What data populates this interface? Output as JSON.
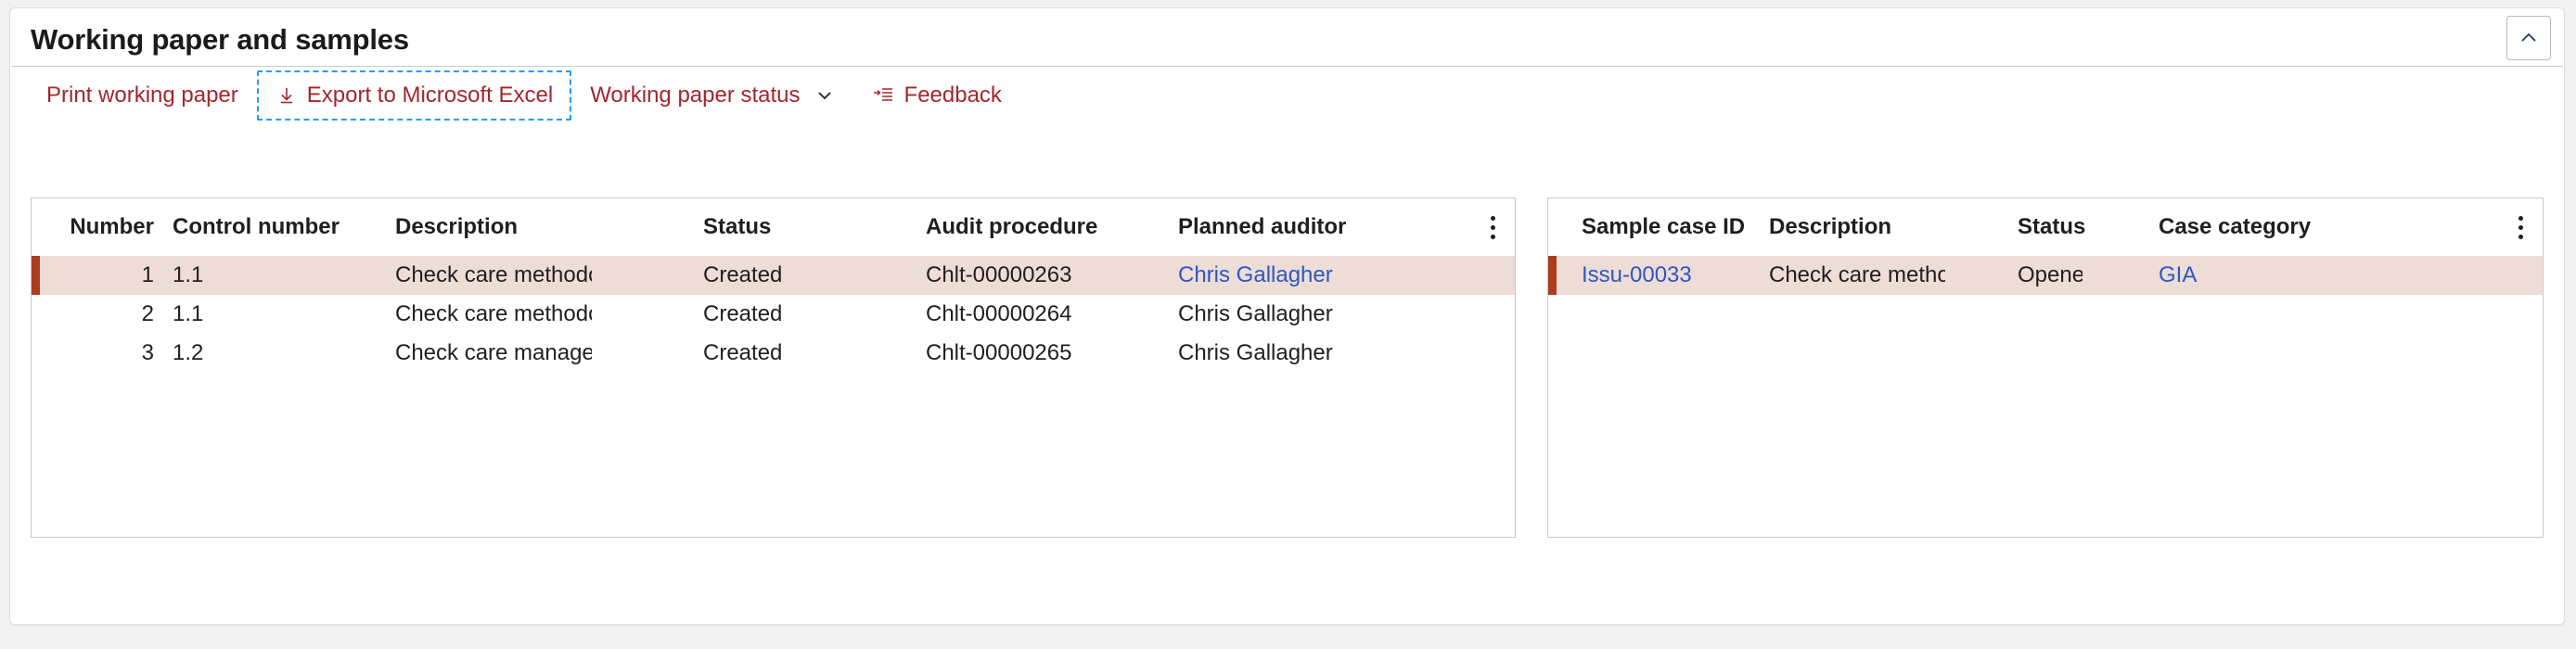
{
  "panel": {
    "title": "Working paper and samples",
    "collapse_icon": "chevron-up-icon"
  },
  "toolbar": {
    "buttons": [
      {
        "label": "Print working paper",
        "icon": null,
        "focused": false,
        "chevron": false
      },
      {
        "label": "Export to Microsoft Excel",
        "icon": "download-arrow-icon",
        "focused": true,
        "chevron": false
      },
      {
        "label": "Working paper status",
        "icon": null,
        "focused": false,
        "chevron": true
      },
      {
        "label": "Feedback",
        "icon": "arrow-to-list-icon",
        "focused": false,
        "chevron": false
      }
    ]
  },
  "colors": {
    "accent": "#a4262c",
    "link": "#2b58c4",
    "selected_row_bg": "#eedcd6",
    "selected_row_bar": "#ad3b1d",
    "focus_outline": "#2899f5"
  },
  "working_paper_grid": {
    "headers": [
      "Number",
      "Control number",
      "Description",
      "Status",
      "Audit procedure",
      "Planned auditor"
    ],
    "overflow_icon": "more-vertical-icon",
    "rows": [
      {
        "number": "1",
        "control_number": "1.1",
        "description": "Check care methodology",
        "status": "Created",
        "audit_procedure": "Chlt-00000263",
        "planned_auditor": "Chris Gallagher",
        "selected": true,
        "auditor_is_link": true
      },
      {
        "number": "2",
        "control_number": "1.1",
        "description": "Check care methodology",
        "status": "Created",
        "audit_procedure": "Chlt-00000264",
        "planned_auditor": "Chris Gallagher",
        "selected": false,
        "auditor_is_link": false
      },
      {
        "number": "3",
        "control_number": "1.2",
        "description": "Check care management",
        "status": "Created",
        "audit_procedure": "Chlt-00000265",
        "planned_auditor": "Chris Gallagher",
        "selected": false,
        "auditor_is_link": false
      }
    ]
  },
  "samples_grid": {
    "headers": [
      "Sample case ID",
      "Description",
      "Status",
      "Case category"
    ],
    "overflow_icon": "more-vertical-icon",
    "rows": [
      {
        "sample_case_id": "Issu-00033",
        "description": "Check care methodology",
        "status": "Opened",
        "case_category": "GIA",
        "selected": true,
        "id_is_link": true,
        "category_is_link": true
      }
    ]
  }
}
